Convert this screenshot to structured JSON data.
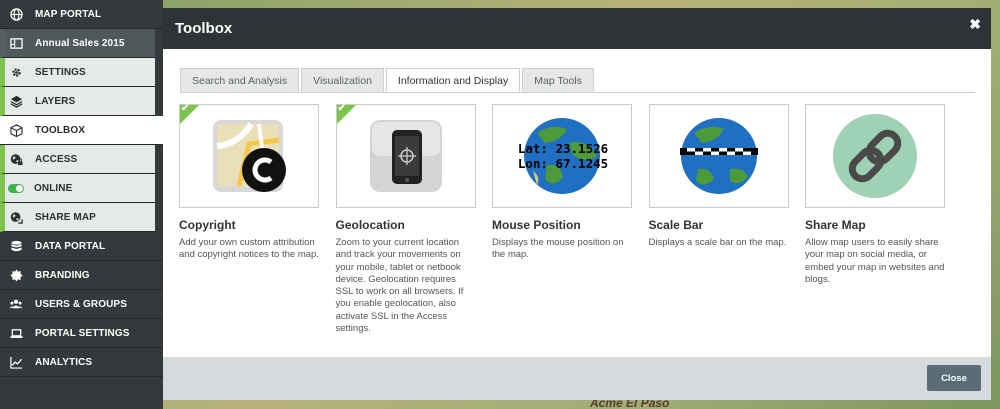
{
  "sidebar": {
    "items": [
      {
        "label": "MAP PORTAL",
        "icon": "globe-icon"
      },
      {
        "label": "Annual Sales 2015",
        "icon": "map-frame-icon"
      },
      {
        "label": "SETTINGS",
        "icon": "gear-icon"
      },
      {
        "label": "LAYERS",
        "icon": "layers-icon"
      },
      {
        "label": "TOOLBOX",
        "icon": "cube-icon"
      },
      {
        "label": "ACCESS",
        "icon": "globe-lock-icon"
      },
      {
        "label": "ONLINE",
        "icon": "toggle-icon"
      },
      {
        "label": "SHARE MAP",
        "icon": "share-globe-icon"
      },
      {
        "label": "DATA PORTAL",
        "icon": "database-icon"
      },
      {
        "label": "BRANDING",
        "icon": "badge-icon"
      },
      {
        "label": "USERS & GROUPS",
        "icon": "users-icon"
      },
      {
        "label": "PORTAL SETTINGS",
        "icon": "laptop-icon"
      },
      {
        "label": "ANALYTICS",
        "icon": "chart-icon"
      }
    ]
  },
  "modal": {
    "title": "Toolbox",
    "close_icon": "✖",
    "tabs": [
      {
        "label": "Search and Analysis"
      },
      {
        "label": "Visualization"
      },
      {
        "label": "Information and Display"
      },
      {
        "label": "Map Tools"
      }
    ],
    "active_tab": "Information and Display",
    "tools": [
      {
        "name": "Copyright",
        "desc": "Add your own custom attribution and copyright notices to the map.",
        "enabled": true
      },
      {
        "name": "Geolocation",
        "desc": "Zoom to your current location and track your movements on your mobile, tablet or netbook device. Geolocation requires SSL to work on all browsers. If you enable geolocation, also activate SSL in the Access settings.",
        "enabled": true
      },
      {
        "name": "Mouse Position",
        "desc": "Displays the mouse position on the map.",
        "enabled": false,
        "lat_text": "Lat: 23.1526",
        "lon_text": "Lon: 67.1245"
      },
      {
        "name": "Scale Bar",
        "desc": "Displays a scale bar on the map.",
        "enabled": false
      },
      {
        "name": "Share Map",
        "desc": "Allow map users to easily share your map on social media, or embed your map in websites and blogs.",
        "enabled": false
      }
    ],
    "close_button": "Close"
  },
  "background": {
    "map_label": "Acme El Paso"
  },
  "colors": {
    "accent_green": "#7dc44d",
    "sidebar_bg": "#34393b",
    "header_bg": "#2e3335",
    "close_btn": "#5a6d76"
  }
}
